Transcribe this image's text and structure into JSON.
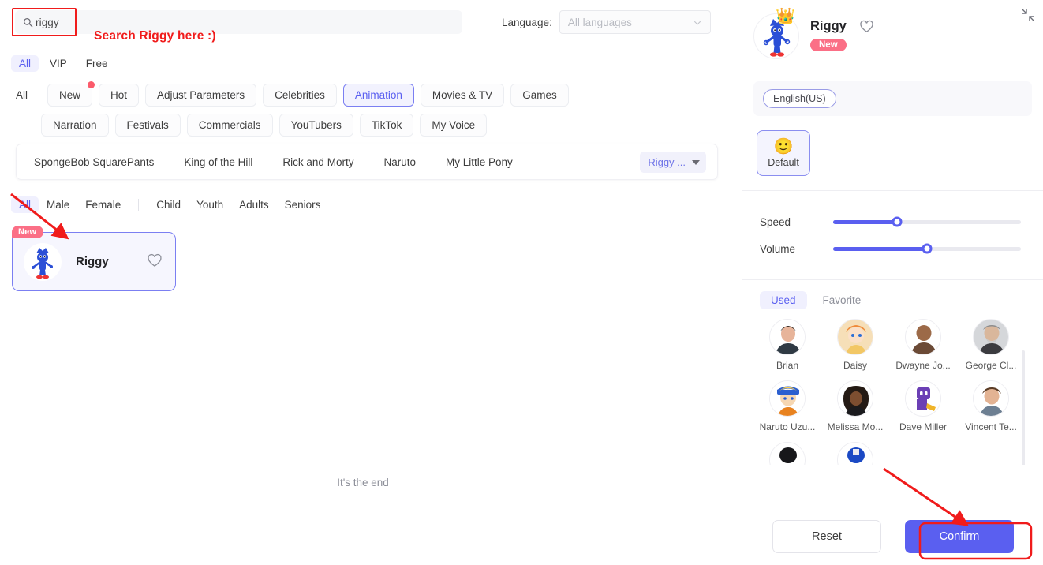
{
  "search": {
    "value": "riggy",
    "icon": "search-icon",
    "annotation": "Search Riggy here :)"
  },
  "language": {
    "label": "Language:",
    "value": "All languages"
  },
  "tier_tabs": [
    {
      "label": "All",
      "active": true
    },
    {
      "label": "VIP",
      "active": false
    },
    {
      "label": "Free",
      "active": false
    }
  ],
  "categories": {
    "all_label": "All",
    "row1": [
      {
        "label": "New",
        "selected": false,
        "dot": true
      },
      {
        "label": "Hot",
        "selected": false,
        "dot": false
      },
      {
        "label": "Adjust Parameters",
        "selected": false,
        "dot": false
      },
      {
        "label": "Celebrities",
        "selected": false,
        "dot": false
      },
      {
        "label": "Animation",
        "selected": true,
        "dot": false
      },
      {
        "label": "Movies & TV",
        "selected": false,
        "dot": false
      },
      {
        "label": "Games",
        "selected": false,
        "dot": false
      }
    ],
    "row2": [
      {
        "label": "Narration",
        "selected": false,
        "dot": false
      },
      {
        "label": "Festivals",
        "selected": false,
        "dot": false
      },
      {
        "label": "Commercials",
        "selected": false,
        "dot": false
      },
      {
        "label": "YouTubers",
        "selected": false,
        "dot": false
      },
      {
        "label": "TikTok",
        "selected": false,
        "dot": false
      },
      {
        "label": "My Voice",
        "selected": false,
        "dot": false
      }
    ]
  },
  "subcategories": {
    "items": [
      "SpongeBob SquarePants",
      "King of the Hill",
      "Rick and Morty",
      "Naruto",
      "My Little Pony"
    ],
    "dropdown_value": "Riggy ..."
  },
  "gender_filter": [
    {
      "label": "All",
      "active": true
    },
    {
      "label": "Male",
      "active": false
    },
    {
      "label": "Female",
      "active": false
    },
    {
      "label": "Child",
      "active": false
    },
    {
      "label": "Youth",
      "active": false
    },
    {
      "label": "Adults",
      "active": false
    },
    {
      "label": "Seniors",
      "active": false
    }
  ],
  "voice_card": {
    "name": "Riggy",
    "badge": "New",
    "heart_icon": "heart-icon"
  },
  "end_text": "It's the end",
  "detail_panel": {
    "name": "Riggy",
    "badge": "New",
    "language_chip": "English(US)",
    "collapse_icon": "collapse-icon",
    "heart_icon": "heart-icon",
    "emotion": {
      "label": "Default",
      "emoji": "🙂"
    },
    "sliders": [
      {
        "label": "Speed",
        "percent": 34
      },
      {
        "label": "Volume",
        "percent": 50
      }
    ],
    "used_tabs": [
      {
        "label": "Used",
        "active": true
      },
      {
        "label": "Favorite",
        "active": false
      }
    ],
    "avatars": [
      {
        "name": "Brian"
      },
      {
        "name": "Daisy"
      },
      {
        "name": "Dwayne Jo..."
      },
      {
        "name": "George Cl..."
      },
      {
        "name": "Naruto Uzu..."
      },
      {
        "name": "Melissa Mo..."
      },
      {
        "name": "Dave Miller"
      },
      {
        "name": "Vincent Te..."
      }
    ],
    "footer": {
      "reset": "Reset",
      "confirm": "Confirm"
    }
  },
  "accent": {
    "primary": "#5a5ff0",
    "badge": "#fb6f86",
    "annotation": "#f01b1b"
  }
}
